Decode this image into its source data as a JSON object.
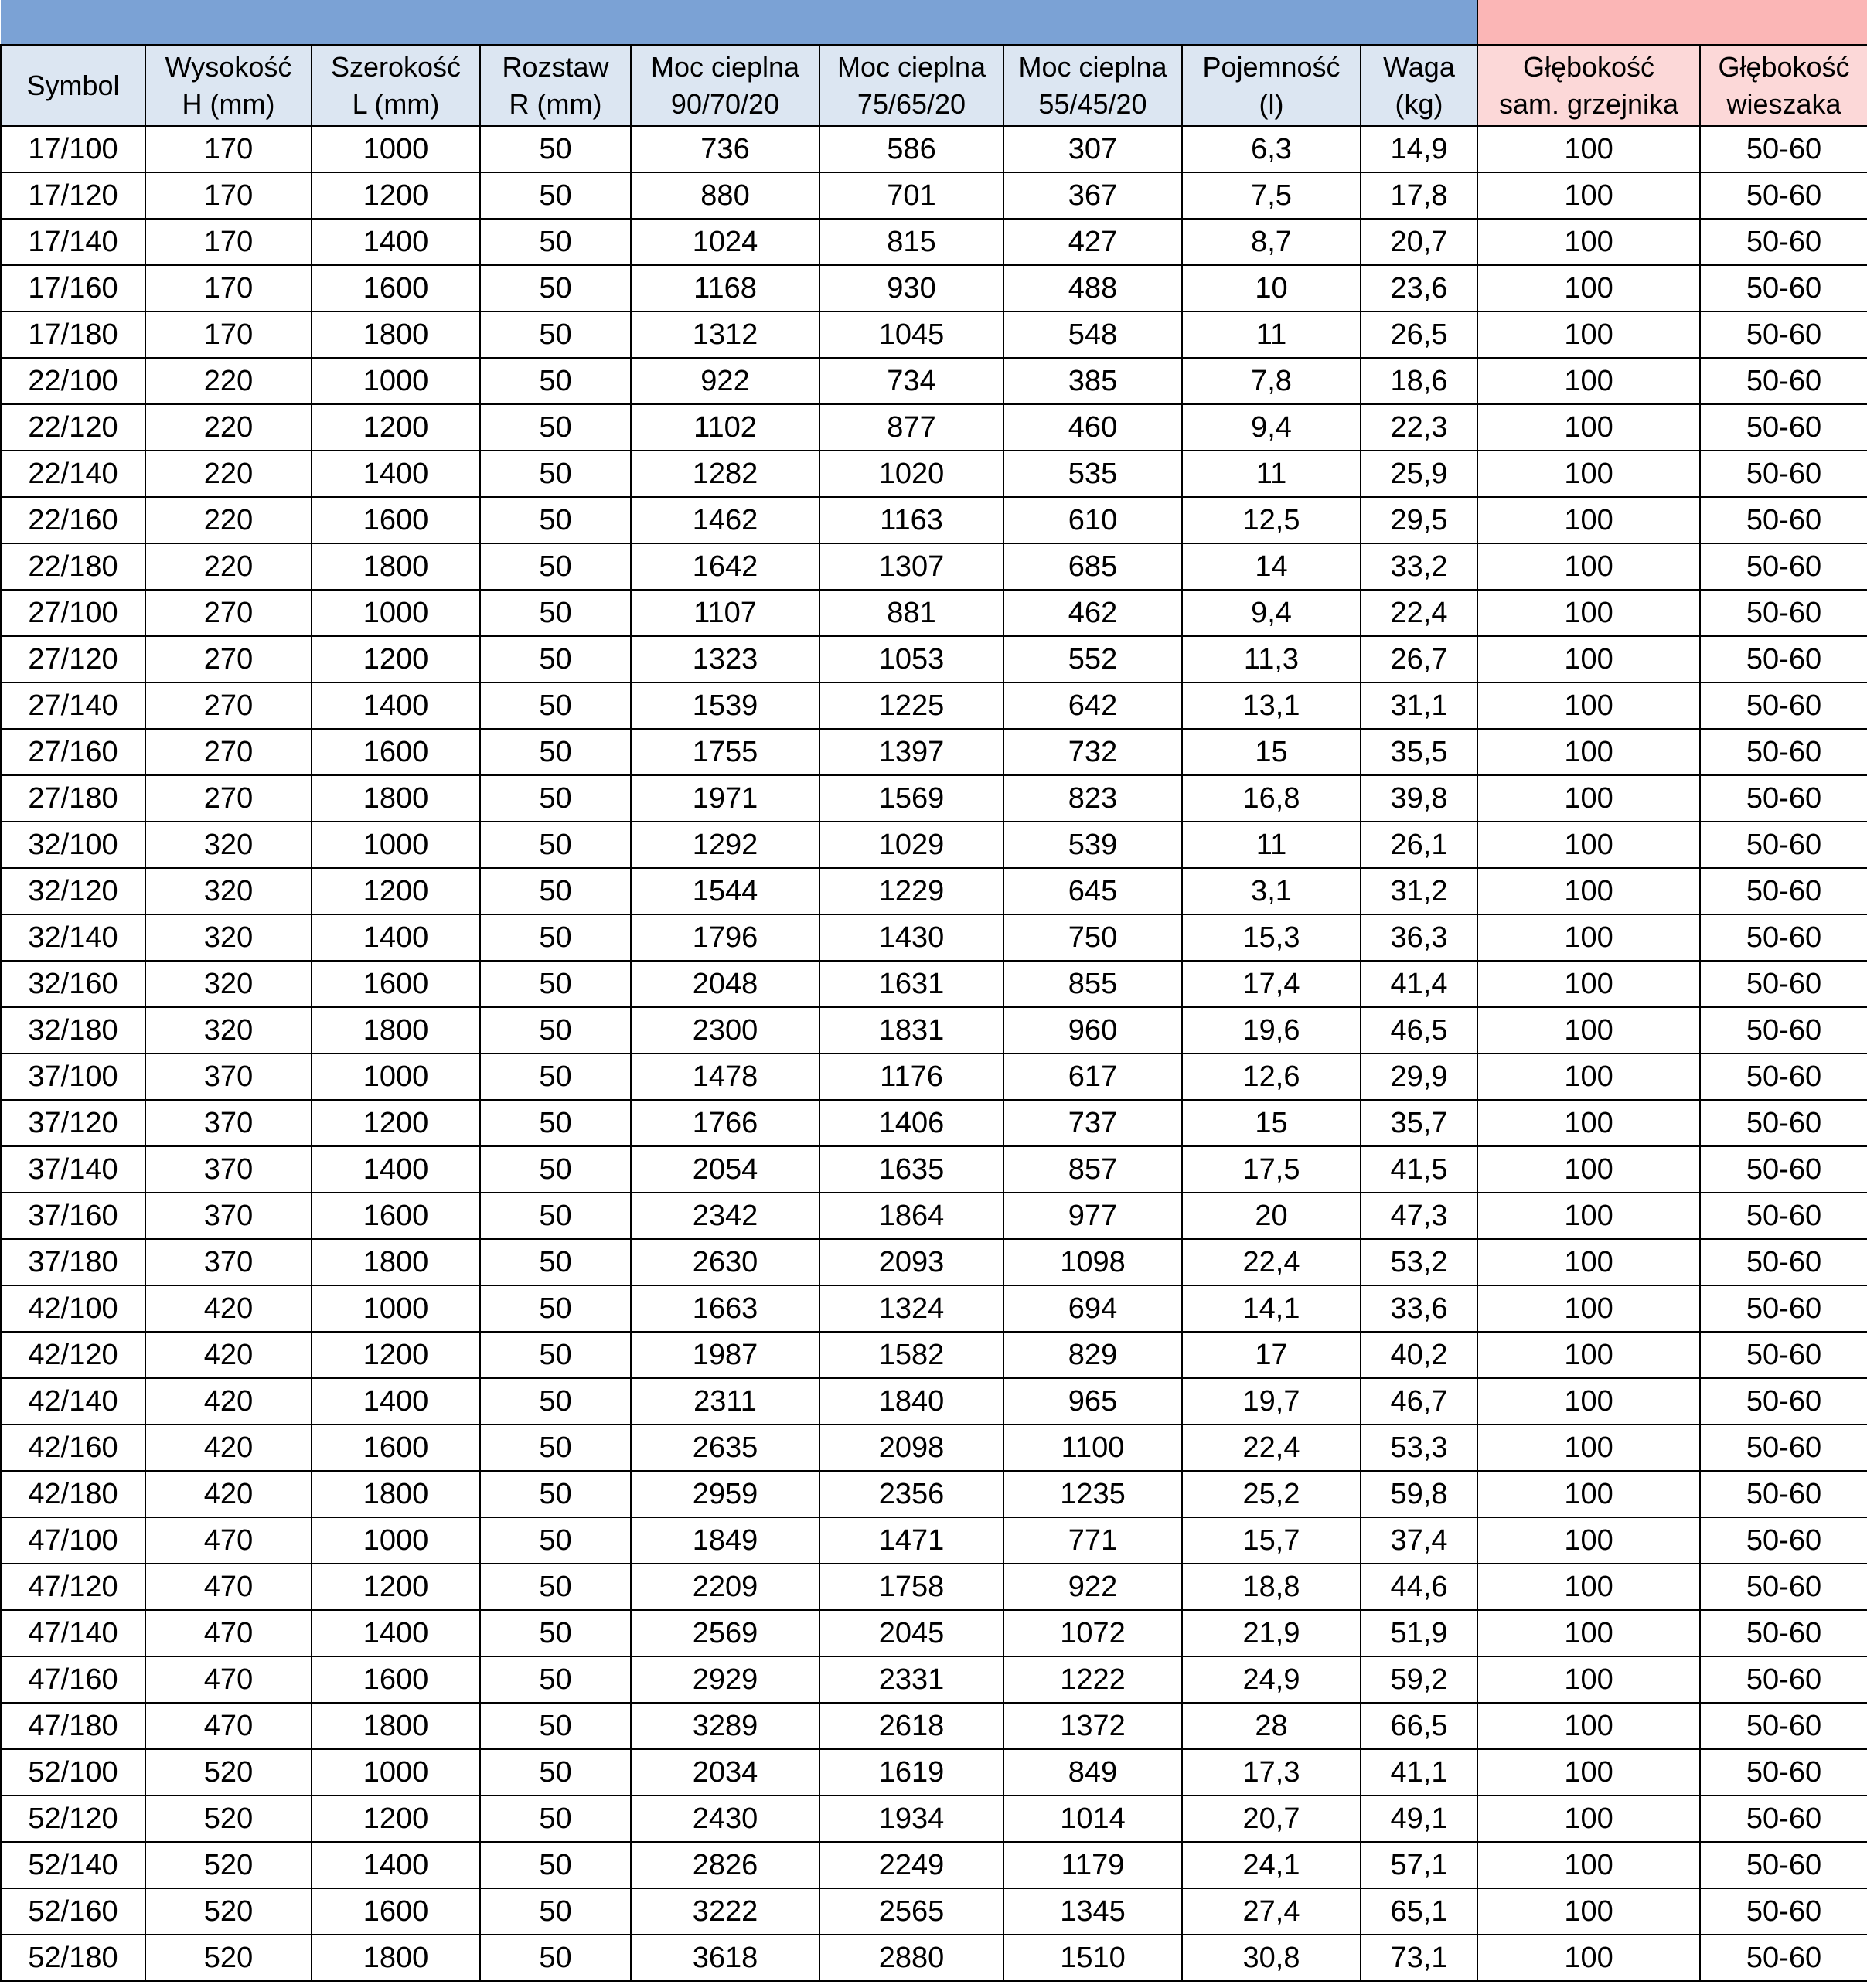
{
  "header": {
    "columns": [
      {
        "line1": "Symbol",
        "line2": ""
      },
      {
        "line1": "Wysokość",
        "line2": "H (mm)"
      },
      {
        "line1": "Szerokość",
        "line2": "L (mm)"
      },
      {
        "line1": "Rozstaw",
        "line2": "R (mm)"
      },
      {
        "line1": "Moc cieplna",
        "line2": "90/70/20"
      },
      {
        "line1": "Moc cieplna",
        "line2": "75/65/20"
      },
      {
        "line1": "Moc cieplna",
        "line2": "55/45/20"
      },
      {
        "line1": "Pojemność",
        "line2": "(l)"
      },
      {
        "line1": "Waga",
        "line2": "(kg)"
      },
      {
        "line1": "Głębokość",
        "line2": "sam. grzejnika"
      },
      {
        "line1": "Głębokość",
        "line2": "wieszaka"
      }
    ]
  },
  "colors": {
    "blue_band": "#7ba2d5",
    "pink_band": "#fbb6b6",
    "header_blue": "#dce6f2",
    "header_pink": "#fcd8d8"
  },
  "rows": [
    [
      "17/100",
      "170",
      "1000",
      "50",
      "736",
      "586",
      "307",
      "6,3",
      "14,9",
      "100",
      "50-60"
    ],
    [
      "17/120",
      "170",
      "1200",
      "50",
      "880",
      "701",
      "367",
      "7,5",
      "17,8",
      "100",
      "50-60"
    ],
    [
      "17/140",
      "170",
      "1400",
      "50",
      "1024",
      "815",
      "427",
      "8,7",
      "20,7",
      "100",
      "50-60"
    ],
    [
      "17/160",
      "170",
      "1600",
      "50",
      "1168",
      "930",
      "488",
      "10",
      "23,6",
      "100",
      "50-60"
    ],
    [
      "17/180",
      "170",
      "1800",
      "50",
      "1312",
      "1045",
      "548",
      "11",
      "26,5",
      "100",
      "50-60"
    ],
    [
      "22/100",
      "220",
      "1000",
      "50",
      "922",
      "734",
      "385",
      "7,8",
      "18,6",
      "100",
      "50-60"
    ],
    [
      "22/120",
      "220",
      "1200",
      "50",
      "1102",
      "877",
      "460",
      "9,4",
      "22,3",
      "100",
      "50-60"
    ],
    [
      "22/140",
      "220",
      "1400",
      "50",
      "1282",
      "1020",
      "535",
      "11",
      "25,9",
      "100",
      "50-60"
    ],
    [
      "22/160",
      "220",
      "1600",
      "50",
      "1462",
      "1163",
      "610",
      "12,5",
      "29,5",
      "100",
      "50-60"
    ],
    [
      "22/180",
      "220",
      "1800",
      "50",
      "1642",
      "1307",
      "685",
      "14",
      "33,2",
      "100",
      "50-60"
    ],
    [
      "27/100",
      "270",
      "1000",
      "50",
      "1107",
      "881",
      "462",
      "9,4",
      "22,4",
      "100",
      "50-60"
    ],
    [
      "27/120",
      "270",
      "1200",
      "50",
      "1323",
      "1053",
      "552",
      "11,3",
      "26,7",
      "100",
      "50-60"
    ],
    [
      "27/140",
      "270",
      "1400",
      "50",
      "1539",
      "1225",
      "642",
      "13,1",
      "31,1",
      "100",
      "50-60"
    ],
    [
      "27/160",
      "270",
      "1600",
      "50",
      "1755",
      "1397",
      "732",
      "15",
      "35,5",
      "100",
      "50-60"
    ],
    [
      "27/180",
      "270",
      "1800",
      "50",
      "1971",
      "1569",
      "823",
      "16,8",
      "39,8",
      "100",
      "50-60"
    ],
    [
      "32/100",
      "320",
      "1000",
      "50",
      "1292",
      "1029",
      "539",
      "11",
      "26,1",
      "100",
      "50-60"
    ],
    [
      "32/120",
      "320",
      "1200",
      "50",
      "1544",
      "1229",
      "645",
      "3,1",
      "31,2",
      "100",
      "50-60"
    ],
    [
      "32/140",
      "320",
      "1400",
      "50",
      "1796",
      "1430",
      "750",
      "15,3",
      "36,3",
      "100",
      "50-60"
    ],
    [
      "32/160",
      "320",
      "1600",
      "50",
      "2048",
      "1631",
      "855",
      "17,4",
      "41,4",
      "100",
      "50-60"
    ],
    [
      "32/180",
      "320",
      "1800",
      "50",
      "2300",
      "1831",
      "960",
      "19,6",
      "46,5",
      "100",
      "50-60"
    ],
    [
      "37/100",
      "370",
      "1000",
      "50",
      "1478",
      "1176",
      "617",
      "12,6",
      "29,9",
      "100",
      "50-60"
    ],
    [
      "37/120",
      "370",
      "1200",
      "50",
      "1766",
      "1406",
      "737",
      "15",
      "35,7",
      "100",
      "50-60"
    ],
    [
      "37/140",
      "370",
      "1400",
      "50",
      "2054",
      "1635",
      "857",
      "17,5",
      "41,5",
      "100",
      "50-60"
    ],
    [
      "37/160",
      "370",
      "1600",
      "50",
      "2342",
      "1864",
      "977",
      "20",
      "47,3",
      "100",
      "50-60"
    ],
    [
      "37/180",
      "370",
      "1800",
      "50",
      "2630",
      "2093",
      "1098",
      "22,4",
      "53,2",
      "100",
      "50-60"
    ],
    [
      "42/100",
      "420",
      "1000",
      "50",
      "1663",
      "1324",
      "694",
      "14,1",
      "33,6",
      "100",
      "50-60"
    ],
    [
      "42/120",
      "420",
      "1200",
      "50",
      "1987",
      "1582",
      "829",
      "17",
      "40,2",
      "100",
      "50-60"
    ],
    [
      "42/140",
      "420",
      "1400",
      "50",
      "2311",
      "1840",
      "965",
      "19,7",
      "46,7",
      "100",
      "50-60"
    ],
    [
      "42/160",
      "420",
      "1600",
      "50",
      "2635",
      "2098",
      "1100",
      "22,4",
      "53,3",
      "100",
      "50-60"
    ],
    [
      "42/180",
      "420",
      "1800",
      "50",
      "2959",
      "2356",
      "1235",
      "25,2",
      "59,8",
      "100",
      "50-60"
    ],
    [
      "47/100",
      "470",
      "1000",
      "50",
      "1849",
      "1471",
      "771",
      "15,7",
      "37,4",
      "100",
      "50-60"
    ],
    [
      "47/120",
      "470",
      "1200",
      "50",
      "2209",
      "1758",
      "922",
      "18,8",
      "44,6",
      "100",
      "50-60"
    ],
    [
      "47/140",
      "470",
      "1400",
      "50",
      "2569",
      "2045",
      "1072",
      "21,9",
      "51,9",
      "100",
      "50-60"
    ],
    [
      "47/160",
      "470",
      "1600",
      "50",
      "2929",
      "2331",
      "1222",
      "24,9",
      "59,2",
      "100",
      "50-60"
    ],
    [
      "47/180",
      "470",
      "1800",
      "50",
      "3289",
      "2618",
      "1372",
      "28",
      "66,5",
      "100",
      "50-60"
    ],
    [
      "52/100",
      "520",
      "1000",
      "50",
      "2034",
      "1619",
      "849",
      "17,3",
      "41,1",
      "100",
      "50-60"
    ],
    [
      "52/120",
      "520",
      "1200",
      "50",
      "2430",
      "1934",
      "1014",
      "20,7",
      "49,1",
      "100",
      "50-60"
    ],
    [
      "52/140",
      "520",
      "1400",
      "50",
      "2826",
      "2249",
      "1179",
      "24,1",
      "57,1",
      "100",
      "50-60"
    ],
    [
      "52/160",
      "520",
      "1600",
      "50",
      "3222",
      "2565",
      "1345",
      "27,4",
      "65,1",
      "100",
      "50-60"
    ],
    [
      "52/180",
      "520",
      "1800",
      "50",
      "3618",
      "2880",
      "1510",
      "30,8",
      "73,1",
      "100",
      "50-60"
    ]
  ]
}
